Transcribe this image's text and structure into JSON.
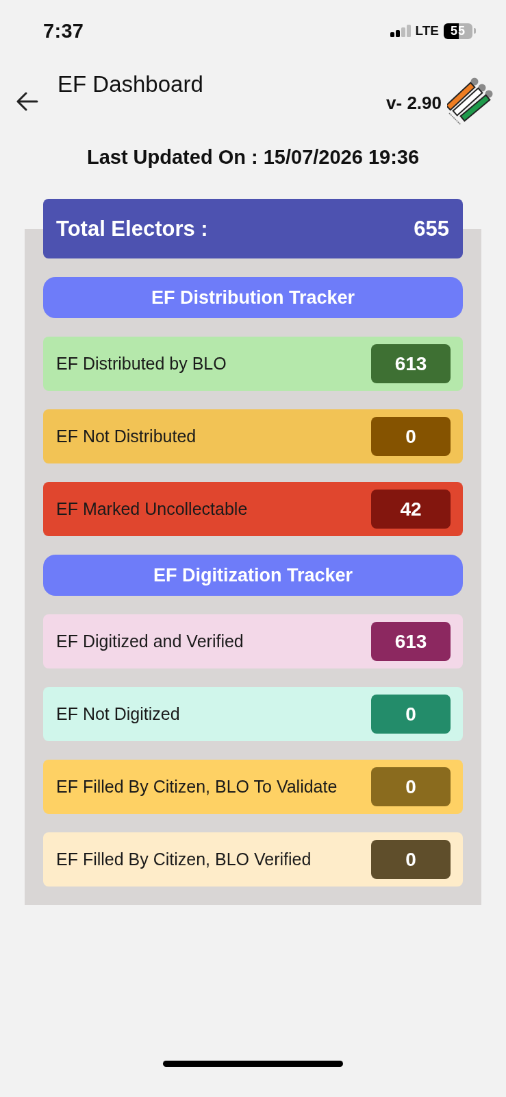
{
  "status_bar": {
    "time": "7:37",
    "network": "LTE",
    "battery": "55"
  },
  "header": {
    "title": "EF Dashboard",
    "version": "v- 2.90",
    "last_updated": "Last Updated On : 15/07/2026 19:36"
  },
  "total": {
    "label": "Total Electors :",
    "value": "655"
  },
  "sections": [
    {
      "title": "EF Distribution Tracker",
      "rows": [
        {
          "label": "EF Distributed by BLO",
          "color": "#b5e8ab",
          "badge": {
            "value": "613",
            "color": "#3e7033"
          }
        },
        {
          "label": "EF Not Distributed",
          "color": "#f2c355",
          "badge": {
            "value": "0",
            "color": "#855300"
          }
        },
        {
          "label": "EF Marked Uncollectable",
          "color": "#e0462e",
          "badge": {
            "value": "42",
            "color": "#83160e"
          }
        }
      ]
    },
    {
      "title": "EF Digitization Tracker",
      "rows": [
        {
          "label": "EF Digitized and Verified",
          "color": "#f3d8e8",
          "badge": {
            "value": "613",
            "color": "#8c2860"
          }
        },
        {
          "label": "EF Not Digitized",
          "color": "#d0f6eb",
          "badge": {
            "value": "0",
            "color": "#238c6a"
          }
        },
        {
          "label": "EF Filled By Citizen, BLO To Validate",
          "color": "#fed164",
          "badge": {
            "value": "0",
            "color": "#8a6b1e"
          }
        },
        {
          "label": "EF Filled By Citizen, BLO Verified",
          "color": "#feecc9",
          "badge": {
            "value": "0",
            "color": "#5f4e2b"
          }
        }
      ]
    }
  ]
}
